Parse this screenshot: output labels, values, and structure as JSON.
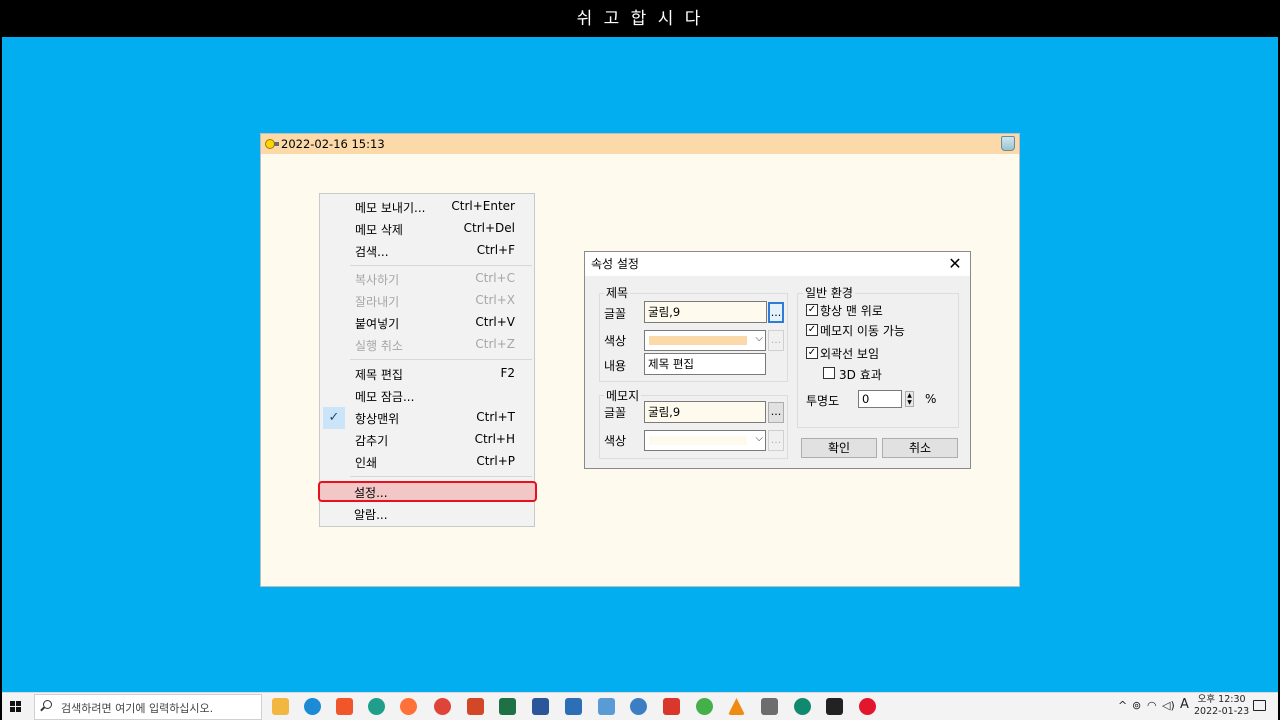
{
  "banner": {
    "title": "쉬 고 합 시 다"
  },
  "memo": {
    "title": "2022-02-16 15:13"
  },
  "context_menu": {
    "items": [
      {
        "label": "메모 보내기...",
        "shortcut": "Ctrl+Enter",
        "enabled": true
      },
      {
        "label": "메모 삭제",
        "shortcut": "Ctrl+Del",
        "enabled": true
      },
      {
        "label": "검색...",
        "shortcut": "Ctrl+F",
        "enabled": true
      },
      {
        "label": "복사하기",
        "shortcut": "Ctrl+C",
        "enabled": false
      },
      {
        "label": "잘라내기",
        "shortcut": "Ctrl+X",
        "enabled": false
      },
      {
        "label": "붙여넣기",
        "shortcut": "Ctrl+V",
        "enabled": true
      },
      {
        "label": "실행 취소",
        "shortcut": "Ctrl+Z",
        "enabled": false
      },
      {
        "label": "제목 편집",
        "shortcut": "F2",
        "enabled": true
      },
      {
        "label": "메모 잠금...",
        "shortcut": "",
        "enabled": true
      },
      {
        "label": "항상맨위",
        "shortcut": "Ctrl+T",
        "enabled": true,
        "checked": true
      },
      {
        "label": "감추기",
        "shortcut": "Ctrl+H",
        "enabled": true
      },
      {
        "label": "인쇄",
        "shortcut": "Ctrl+P",
        "enabled": true
      },
      {
        "label": "설정...",
        "shortcut": "",
        "enabled": true,
        "highlighted": true
      },
      {
        "label": "알람...",
        "shortcut": "",
        "enabled": true
      }
    ]
  },
  "dialog": {
    "title": "속성 설정",
    "title_group": {
      "caption": "제목",
      "font_label": "글꼴",
      "font_value": "굴림,9",
      "color_label": "색상",
      "color_value": "#fcd9a8",
      "content_label": "내용",
      "content_value": "제목 편집"
    },
    "memo_group": {
      "caption": "메모지",
      "font_label": "글꼴",
      "font_value": "굴림,9",
      "color_label": "색상",
      "color_value": "#fffaee"
    },
    "general_group": {
      "caption": "일반 환경",
      "always_on_top": {
        "label": "항상 맨 위로",
        "checked": true
      },
      "movable": {
        "label": "메모지 이동 가능",
        "checked": true
      },
      "show_border": {
        "label": "외곽선 보임",
        "checked": true
      },
      "effect_3d": {
        "label": "3D 효과",
        "checked": false
      },
      "opacity_label": "투명도",
      "opacity_value": "0",
      "opacity_unit": "%"
    },
    "ok_label": "확인",
    "cancel_label": "취소",
    "dots_label": "..."
  },
  "taskbar": {
    "search_placeholder": "검색하려면 여기에 입력하십시오.",
    "apps": [
      "file-explorer",
      "edge",
      "brave",
      "app",
      "firefox",
      "chrome",
      "powerpoint",
      "excel",
      "word",
      "app",
      "app",
      "app",
      "app",
      "app",
      "calculator",
      "edge-dev",
      "sticky-notes",
      "opera"
    ],
    "ime": "A",
    "time": "오후 12:30",
    "date": "2022-01-23"
  }
}
